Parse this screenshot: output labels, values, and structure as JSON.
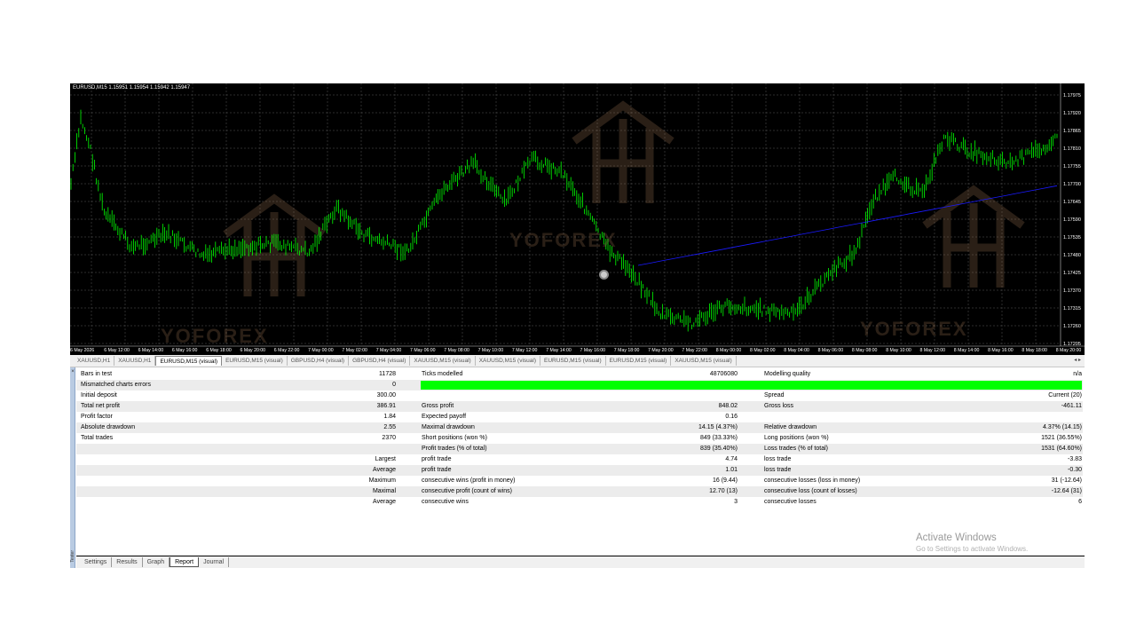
{
  "chart": {
    "header": "EURUSD,M15  1.15951 1.15954 1.15942 1.15947",
    "watermark_text": "YOFOREX",
    "price_labels": [
      "1.17975",
      "1.17920",
      "1.17865",
      "1.17810",
      "1.17755",
      "1.17700",
      "1.17645",
      "1.17590",
      "1.17535",
      "1.17480",
      "1.17425",
      "1.17370",
      "1.17315",
      "1.17260",
      "1.17205"
    ],
    "time_labels": [
      "6 May 2026",
      "6 May 12:00",
      "6 May 14:00",
      "6 May 16:00",
      "6 May 18:00",
      "6 May 20:00",
      "6 May 22:00",
      "7 May 00:00",
      "7 May 02:00",
      "7 May 04:00",
      "7 May 06:00",
      "7 May 08:00",
      "7 May 10:00",
      "7 May 12:00",
      "7 May 14:00",
      "7 May 16:00",
      "7 May 18:00",
      "7 May 20:00",
      "7 May 22:00",
      "8 May 00:00",
      "8 May 02:00",
      "8 May 04:00",
      "8 May 06:00",
      "8 May 08:00",
      "8 May 10:00",
      "8 May 12:00",
      "8 May 14:00",
      "8 May 16:00",
      "8 May 18:00",
      "8 May 20:00"
    ],
    "bar_color": "#00ff00",
    "ma_color": "#1a1aff",
    "grid_color": "#5a5a5a"
  },
  "symbol_tabs": [
    {
      "label": "XAUUSD,H1"
    },
    {
      "label": "XAUUSD,H1"
    },
    {
      "label": "EURUSD,M15 (visual)"
    },
    {
      "label": "EURUSD,M15 (visual)"
    },
    {
      "label": "GBPUSD,H4 (visual)"
    },
    {
      "label": "GBPUSD,H4 (visual)"
    },
    {
      "label": "XAUUSD,M15 (visual)"
    },
    {
      "label": "XAUUSD,M15 (visual)"
    },
    {
      "label": "EURUSD,M15 (visual)"
    },
    {
      "label": "EURUSD,M15 (visual)"
    },
    {
      "label": "XAUUSD,M15 (visual)"
    }
  ],
  "symbol_tab_arrows": "◂ ▸",
  "side": {
    "label": "Tester",
    "close": "×"
  },
  "report": {
    "r1": {
      "k1": "Bars in test",
      "v1": "11728",
      "k2": "Ticks modelled",
      "v2": "48706080",
      "k3": "Modelling quality",
      "v3": "n/a"
    },
    "r2": {
      "k1": "Mismatched charts errors",
      "v1": "0"
    },
    "r3": {
      "k1": "Initial deposit",
      "v1": "300.00",
      "k3": "Spread",
      "v3": "Current (20)"
    },
    "r4": {
      "k1": "Total net profit",
      "v1": "386.91",
      "k2": "Gross profit",
      "v2": "848.02",
      "k3": "Gross loss",
      "v3": "-461.11"
    },
    "r5": {
      "k1": "Profit factor",
      "v1": "1.84",
      "k2": "Expected payoff",
      "v2": "0.16"
    },
    "r6": {
      "k1": "Absolute drawdown",
      "v1": "2.55",
      "k2": "Maximal drawdown",
      "v2": "14.15 (4.37%)",
      "k3": "Relative drawdown",
      "v3": "4.37% (14.15)"
    },
    "r7": {
      "k1": "Total trades",
      "v1": "2370",
      "k2": "Short positions (won %)",
      "v2": "849 (33.33%)",
      "k3": "Long positions (won %)",
      "v3": "1521 (36.55%)"
    },
    "r8": {
      "k2": "Profit trades (% of total)",
      "v2": "839 (35.40%)",
      "k3": "Loss trades (% of total)",
      "v3": "1531 (64.60%)"
    },
    "r9": {
      "lbl": "Largest",
      "k2": "profit trade",
      "v2": "4.74",
      "k3": "loss trade",
      "v3": "-3.83"
    },
    "r10": {
      "lbl": "Average",
      "k2": "profit trade",
      "v2": "1.01",
      "k3": "loss trade",
      "v3": "-0.30"
    },
    "r11": {
      "lbl": "Maximum",
      "k2": "consecutive wins (profit in money)",
      "v2": "16 (9.44)",
      "k3": "consecutive losses (loss in money)",
      "v3": "31 (-12.64)"
    },
    "r12": {
      "lbl": "Maximal",
      "k2": "consecutive profit (count of wins)",
      "v2": "12.70 (13)",
      "k3": "consecutive loss (count of losses)",
      "v3": "-12.64 (31)"
    },
    "r13": {
      "lbl": "Average",
      "k2": "consecutive wins",
      "v2": "3",
      "k3": "consecutive losses",
      "v3": "6"
    },
    "quality_bar_color": "#00ff00"
  },
  "bottom_tabs": [
    {
      "label": "Settings"
    },
    {
      "label": "Results"
    },
    {
      "label": "Graph"
    },
    {
      "label": "Report"
    },
    {
      "label": "Journal"
    }
  ],
  "activate": {
    "title": "Activate Windows",
    "subtitle": "Go to Settings to activate Windows."
  }
}
